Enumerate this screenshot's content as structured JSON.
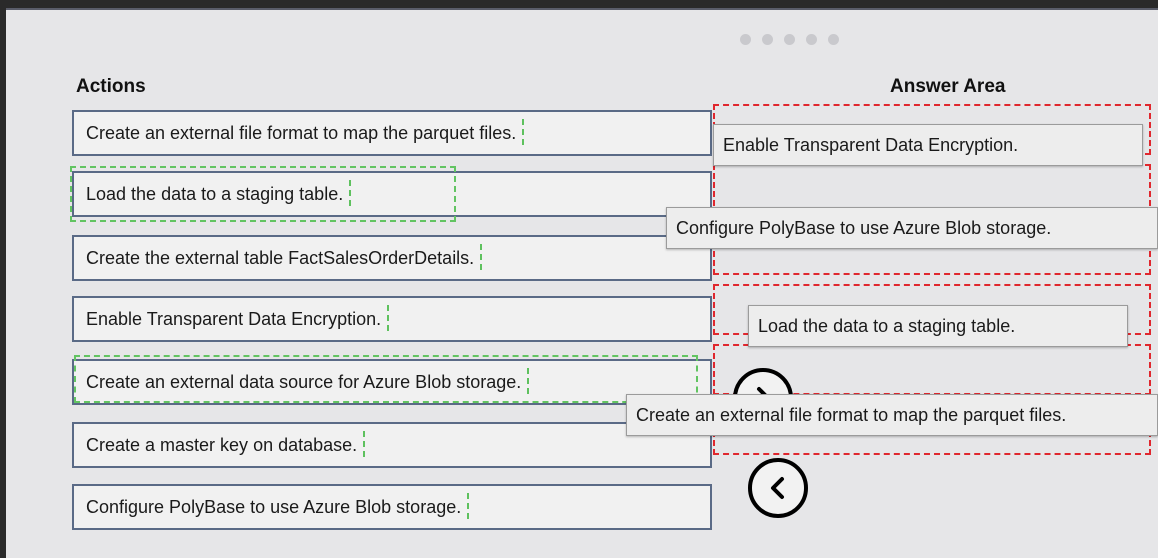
{
  "header": {
    "actions_title": "Actions",
    "answer_area_title": "Answer Area"
  },
  "pager": {
    "dot_count": 5
  },
  "actions": [
    {
      "label": "Create an external file format to map the parquet files."
    },
    {
      "label": "Load the data to a staging table."
    },
    {
      "label": "Create the external table FactSalesOrderDetails."
    },
    {
      "label": "Enable Transparent Data Encryption."
    },
    {
      "label": "Create an external data source for Azure Blob storage."
    },
    {
      "label": "Create a master key on database."
    },
    {
      "label": "Configure PolyBase to use Azure Blob storage."
    }
  ],
  "answer_area": {
    "items": [
      {
        "label": "Enable Transparent Data Encryption."
      },
      {
        "label": "Configure PolyBase to use Azure Blob storage."
      },
      {
        "label": "Load the data to a staging table."
      },
      {
        "label": "Create an external file format to map the parquet files."
      }
    ]
  },
  "controls": {
    "move_up_icon": "chevron-right-icon",
    "move_left_icon": "chevron-left-icon"
  },
  "colors": {
    "drop_slot_border": "#e0272e",
    "drag_hint_border": "#62c462",
    "action_border": "#5a6a86"
  }
}
